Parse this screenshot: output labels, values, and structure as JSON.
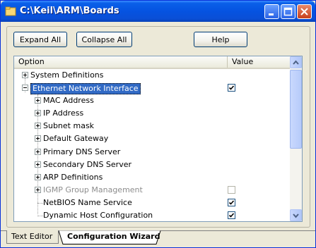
{
  "window": {
    "title": "C:\\Keil\\ARM\\Boards"
  },
  "toolbar": {
    "expand_all": "Expand All",
    "collapse_all": "Collapse All",
    "help": "Help"
  },
  "table": {
    "columns": {
      "option": "Option",
      "value": "Value"
    },
    "rows": [
      {
        "label": "System Definitions",
        "level": 0,
        "expander": "plus",
        "checkbox": "none",
        "state": "normal"
      },
      {
        "label": "Ethernet Network Interface",
        "level": 0,
        "expander": "minus",
        "checkbox": "checked",
        "state": "selected"
      },
      {
        "label": "MAC Address",
        "level": 1,
        "expander": "plus",
        "checkbox": "none",
        "state": "normal"
      },
      {
        "label": "IP Address",
        "level": 1,
        "expander": "plus",
        "checkbox": "none",
        "state": "normal"
      },
      {
        "label": "Subnet mask",
        "level": 1,
        "expander": "plus",
        "checkbox": "none",
        "state": "normal"
      },
      {
        "label": "Default Gateway",
        "level": 1,
        "expander": "plus",
        "checkbox": "none",
        "state": "normal"
      },
      {
        "label": "Primary DNS Server",
        "level": 1,
        "expander": "plus",
        "checkbox": "none",
        "state": "normal"
      },
      {
        "label": "Secondary DNS Server",
        "level": 1,
        "expander": "plus",
        "checkbox": "none",
        "state": "normal"
      },
      {
        "label": "ARP Definitions",
        "level": 1,
        "expander": "plus",
        "checkbox": "none",
        "state": "normal"
      },
      {
        "label": "IGMP Group Management",
        "level": 1,
        "expander": "plus",
        "checkbox": "unchecked",
        "state": "disabled"
      },
      {
        "label": "NetBIOS Name Service",
        "level": 1,
        "expander": "none",
        "checkbox": "checked",
        "state": "normal"
      },
      {
        "label": "Dynamic Host Configuration",
        "level": 1,
        "expander": "none",
        "checkbox": "checked",
        "state": "normal"
      }
    ]
  },
  "tabs": [
    {
      "label": "Text Editor",
      "active": false
    },
    {
      "label": "Configuration Wizard",
      "active": true
    }
  ],
  "icons": {
    "app": "folder-icon",
    "minimize": "minimize-icon",
    "maximize": "maximize-icon",
    "close": "close-icon",
    "scroll_up": "scroll-up-arrow-icon",
    "scroll_down": "scroll-down-arrow-icon"
  },
  "colors": {
    "titlebar": "#0553e1",
    "selection": "#316ac5",
    "window_bg": "#ece9d8"
  }
}
